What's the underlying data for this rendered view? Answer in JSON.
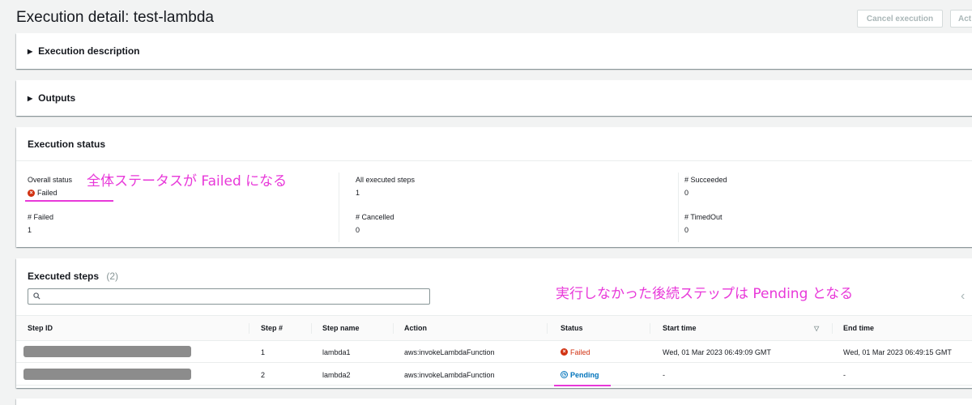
{
  "page": {
    "title": "Execution detail: test-lambda"
  },
  "toolbar": {
    "cancel_label": "Cancel execution",
    "actions_label": "Act"
  },
  "sections": {
    "description_label": "Execution description",
    "outputs_label": "Outputs",
    "status_label": "Execution status"
  },
  "status": {
    "overall_label": "Overall status",
    "overall_value": "Failed",
    "all_steps_label": "All executed steps",
    "all_steps_value": "1",
    "succeeded_label": "# Succeeded",
    "succeeded_value": "0",
    "failed_label": "# Failed",
    "failed_value": "1",
    "cancelled_label": "# Cancelled",
    "cancelled_value": "0",
    "timedout_label": "# TimedOut",
    "timedout_value": "0"
  },
  "annotations": {
    "status_note": "全体ステータスが Failed になる",
    "pending_note": "実行しなかった後続ステップは Pending となる"
  },
  "steps": {
    "title": "Executed steps",
    "count": "(2)",
    "search_placeholder": "",
    "columns": {
      "step_id": "Step ID",
      "step_num": "Step #",
      "step_name": "Step name",
      "action": "Action",
      "status": "Status",
      "start_time": "Start time",
      "end_time": "End time"
    },
    "sort_icon": "▽",
    "prev_page_icon": "‹",
    "rows": [
      {
        "step_num": "1",
        "step_name": "lambda1",
        "action": "aws:invokeLambdaFunction",
        "status": "Failed",
        "start_time": "Wed, 01 Mar 2023 06:49:09 GMT",
        "end_time": "Wed, 01 Mar 2023 06:49:15 GMT"
      },
      {
        "step_num": "2",
        "step_name": "lambda2",
        "action": "aws:invokeLambdaFunction",
        "status": "Pending",
        "start_time": "-",
        "end_time": "-"
      }
    ]
  },
  "colors": {
    "failed": "#d13212",
    "pending": "#0073bb",
    "annotation": "#e838d9"
  }
}
